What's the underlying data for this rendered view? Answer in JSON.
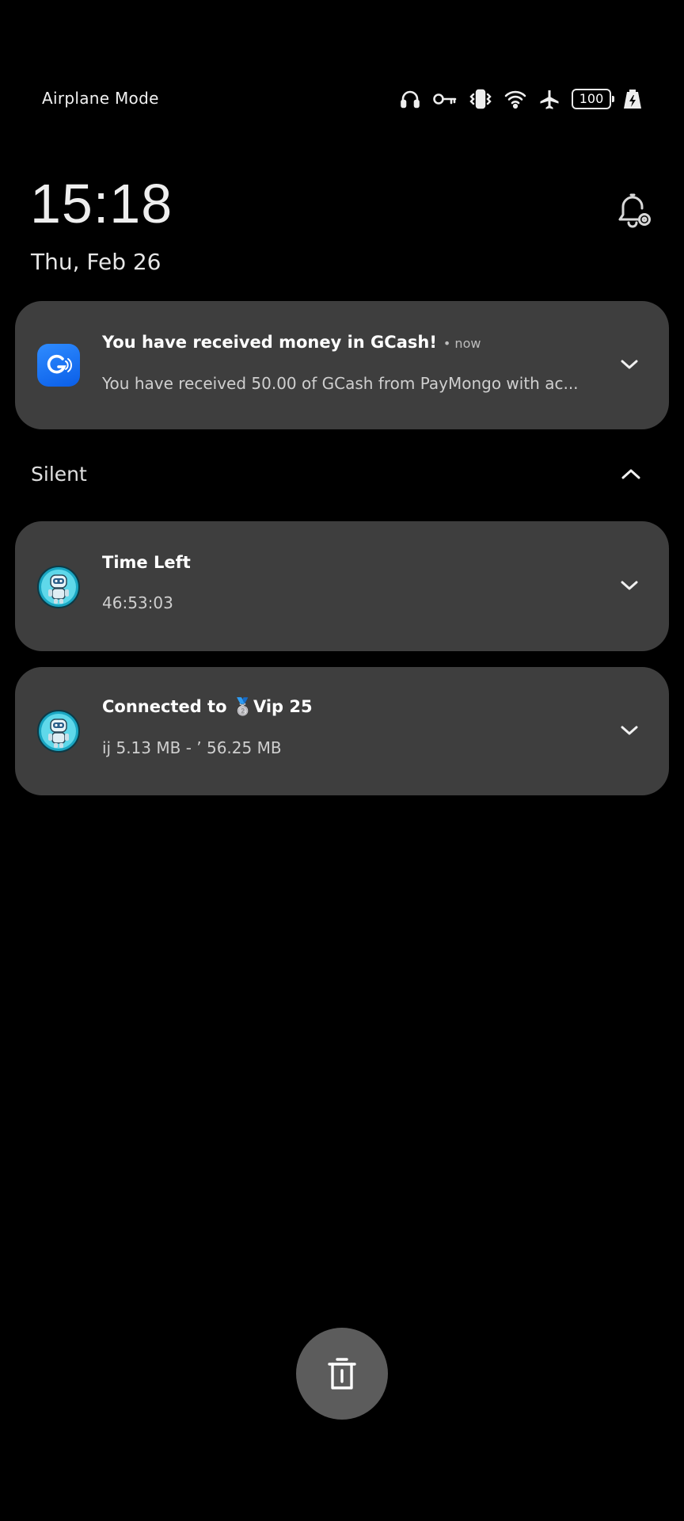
{
  "status_bar": {
    "carrier": "Airplane Mode",
    "battery_level": "100",
    "icons": [
      "headphones-icon",
      "vpn-key-icon",
      "vibrate-icon",
      "wifi-icon",
      "airplane-icon",
      "battery-icon",
      "charging-icon"
    ]
  },
  "lockscreen": {
    "time": "15:18",
    "date": "Thu, Feb 26"
  },
  "notifications": [
    {
      "app_icon": "gcash-icon",
      "title": "You have received money in GCash!",
      "time": "• now",
      "body": "You have received 50.00 of GCash from PayMongo with ac..."
    }
  ],
  "silent_section": {
    "label": "Silent",
    "items": [
      {
        "app_icon": "robot-avatar-icon",
        "title": "Time Left",
        "body": "46:53:03"
      },
      {
        "app_icon": "robot-avatar-icon",
        "title": "Connected to 🥈Vip 25",
        "body": "ij 5.13 MB - ’  56.25 MB"
      }
    ]
  },
  "colors": {
    "background": "#000000",
    "card": "#3e3e3e",
    "clear_button": "#5c5c5c",
    "gcash_blue": "#1a73f0"
  }
}
